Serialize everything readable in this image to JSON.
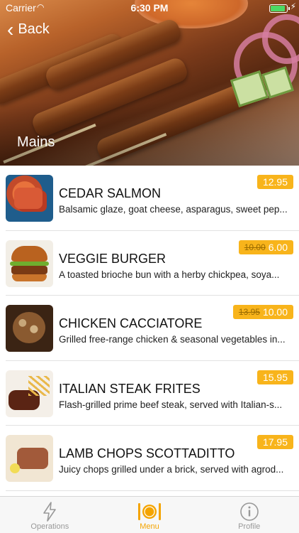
{
  "status_bar": {
    "carrier": "Carrier",
    "time": "6:30 PM"
  },
  "nav": {
    "back_label": "Back",
    "section_title": "Mains"
  },
  "colors": {
    "price_badge": "#f8b41b",
    "tab_active": "#f4a400",
    "tab_inactive": "#999999"
  },
  "menu_items": [
    {
      "name": "CEDAR SALMON",
      "description": "Balsamic glaze, goat cheese, asparagus, sweet pep...",
      "price": "12.95",
      "old_price": ""
    },
    {
      "name": "VEGGIE BURGER",
      "description": "A toasted brioche bun with a herby chickpea, soya...",
      "price": "6.00",
      "old_price": "10.00"
    },
    {
      "name": "CHICKEN CACCIATORE",
      "description": "Grilled free-range chicken & seasonal vegetables in...",
      "price": "10.00",
      "old_price": "13.95"
    },
    {
      "name": "ITALIAN STEAK FRITES",
      "description": "Flash-grilled prime beef steak, served with Italian-s...",
      "price": "15.95",
      "old_price": ""
    },
    {
      "name": "LAMB CHOPS SCOTTADITTO",
      "description": "Juicy chops grilled under a brick, served with agrod...",
      "price": "17.95",
      "old_price": ""
    }
  ],
  "tabs": [
    {
      "label": "Operations",
      "icon": "lightning-icon"
    },
    {
      "label": "Menu",
      "icon": "plate-cutlery-icon"
    },
    {
      "label": "Profile",
      "icon": "info-icon"
    }
  ]
}
